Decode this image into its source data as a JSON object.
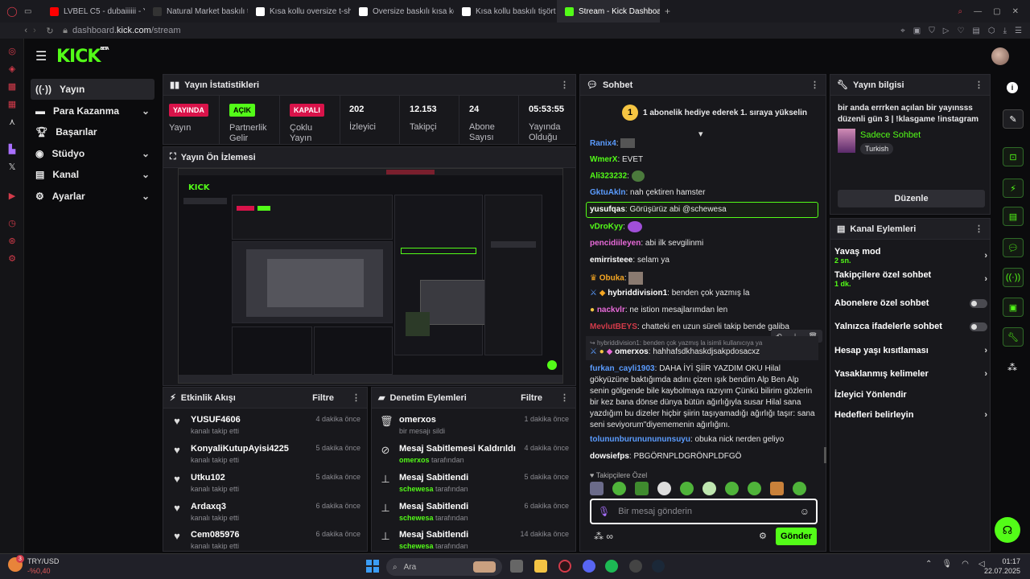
{
  "browser": {
    "tabs": [
      "LVBEL C5 - dubaiiiiii - Yo",
      "Natural Market baskılı t-s",
      "Kısa kollu oversize t-shirt",
      "Oversize baskılı kısa kollu",
      "Kısa kollu baskılı tişört - T",
      "Stream - Kick Dashboard"
    ],
    "address_prefix": "dashboard.",
    "address_host": "kick.com",
    "address_path": "/stream"
  },
  "brand": {
    "logo": "KICK",
    "beta": "BETA",
    "accent": "#53fc18"
  },
  "nav": [
    {
      "label": "Yayın",
      "icon": "broadcast-icon"
    },
    {
      "label": "Para Kazanma",
      "icon": "money-icon"
    },
    {
      "label": "Başarılar",
      "icon": "trophy-icon"
    },
    {
      "label": "Stüdyo",
      "icon": "studio-icon"
    },
    {
      "label": "Kanal",
      "icon": "channel-icon"
    },
    {
      "label": "Ayarlar",
      "icon": "gear-icon"
    }
  ],
  "stats": {
    "title": "Yayın İstatistikleri",
    "items": [
      {
        "badge": "YAYINDA",
        "label": "Yayın"
      },
      {
        "badge": "AÇIK",
        "label": "Partnerlik Gelir"
      },
      {
        "badge": "KAPALI",
        "label": "Çoklu Yayın"
      },
      {
        "value": "202",
        "label": "İzleyici"
      },
      {
        "value": "12.153",
        "label": "Takipçi"
      },
      {
        "value": "24",
        "label": "Abone Sayısı"
      },
      {
        "value": "05:53:55",
        "label": "Yayında Olduğu"
      }
    ]
  },
  "preview": {
    "title": "Yayın Ön İzlemesi"
  },
  "activity": {
    "title": "Etkinlik Akışı",
    "filter": "Filtre",
    "items": [
      {
        "name": "YUSUF4606",
        "action": "kanalı takip etti",
        "time": "4 dakika önce"
      },
      {
        "name": "KonyaliKutupAyisi4225",
        "action": "kanalı takip etti",
        "time": "5 dakika önce"
      },
      {
        "name": "Utku102",
        "action": "kanalı takip etti",
        "time": "5 dakika önce"
      },
      {
        "name": "Ardaxq3",
        "action": "kanalı takip etti",
        "time": "6 dakika önce"
      },
      {
        "name": "Cem085976",
        "action": "kanalı takip etti",
        "time": "6 dakika önce"
      }
    ]
  },
  "moderation": {
    "title": "Denetim Eylemleri",
    "filter": "Filtre",
    "items": [
      {
        "name": "omerxos",
        "action": "bir mesajı sildi",
        "by": "",
        "time": "1 dakika önce",
        "icon": "trash-icon"
      },
      {
        "name": "Mesaj Sabitlemesi Kaldırıldı",
        "action": "tarafından",
        "by": "omerxos",
        "time": "4 dakika önce",
        "icon": "unpin-icon"
      },
      {
        "name": "Mesaj Sabitlendi",
        "action": "tarafından",
        "by": "schewesa",
        "time": "5 dakika önce",
        "icon": "pin-icon"
      },
      {
        "name": "Mesaj Sabitlendi",
        "action": "tarafından",
        "by": "schewesa",
        "time": "6 dakika önce",
        "icon": "pin-icon"
      },
      {
        "name": "Mesaj Sabitlendi",
        "action": "tarafından",
        "by": "schewesa",
        "time": "14 dakika önce",
        "icon": "pin-icon"
      }
    ]
  },
  "chat": {
    "title": "Sohbet",
    "gift": "1 abonelik hediye ederek 1. sıraya yükselin",
    "gift_rank": "1",
    "messages": [
      {
        "user": "Ranix4",
        "color": "#5b9cff",
        "text": ""
      },
      {
        "user": "WmerX",
        "color": "#53fc18",
        "text": "EVET"
      },
      {
        "user": "Ali323232",
        "color": "#53fc18",
        "text": ""
      },
      {
        "user": "GktuAkln",
        "color": "#5b9cff",
        "text": "nah çektiren hamster"
      },
      {
        "user": "yusufqas",
        "color": "#ffffff",
        "text": "Görüşürüz abi @schewesa"
      },
      {
        "user": "vDroKyy",
        "color": "#53fc18",
        "text": ""
      },
      {
        "user": "pencidiileyen",
        "color": "#e86ad9",
        "text": "abi ilk sevgilinmi"
      },
      {
        "user": "emirristeee",
        "color": "#ffffff",
        "text": "selam ya"
      },
      {
        "user": "Obuka",
        "color": "#f5a623",
        "text": ""
      },
      {
        "user": "hybriddivision1",
        "color": "#ffffff",
        "text": "benden çok yazmış la"
      },
      {
        "user": "nackvlr",
        "color": "#e86ad9",
        "text": "ne istion mesajlarımdan len"
      },
      {
        "user": "MevlutBEYS",
        "color": "#d33b4a",
        "text": "chatteki en uzun süreli takip bende galiba"
      },
      {
        "user": "omerxos",
        "color": "#ffffff",
        "text": "hahhafsdkhaskdjsakpdosacxz"
      },
      {
        "user": "furkan_cayli1903",
        "color": "#5b9cff",
        "text": "DAHA İYİ ŞİİR YAZDIM OKU Hilal gökyüzüne baktığımda adını çizen ışık bendim Alp Ben Alp senin gölgende bile kaybolmaya razıyım Çünkü bilirim gözlerin bir kez bana dönse dünya bütün ağırlığıyla susar Hilal sana yazdığım bu dizeler hiçbir şiirin taşıyamadığı ağırlığı taşır: sana seni seviyorum\"diyememenin ağırlığını."
      },
      {
        "user": "tolununburununununsuyu",
        "color": "#5b9cff",
        "text": "obuka nick nerden geliyo"
      },
      {
        "user": "dowsiefps",
        "color": "#ffffff",
        "text": "PBGÖRNPLDGRÖNPLDFGÖ"
      }
    ],
    "reply_to": "hybriddivision1: benden çok yazmış la isimli kullanıcıya ya",
    "followers_only": "Takipçilere Özel",
    "placeholder": "Bir mesaj gönderin",
    "send": "Gönder"
  },
  "info": {
    "title": "Yayın bilgisi",
    "stream_title": "bir anda errrken açılan bir yayınsss düzenli gün 3 | !klasgame !instagram",
    "category": "Sadece Sohbet",
    "tag": "Turkish",
    "edit": "Düzenle"
  },
  "actions": {
    "title": "Kanal Eylemleri",
    "items": [
      {
        "label": "Yavaş mod",
        "sub": "2 sn.",
        "type": "chevron"
      },
      {
        "label": "Takipçilere özel sohbet",
        "sub": "1 dk.",
        "type": "chevron"
      },
      {
        "label": "Abonelere özel sohbet",
        "sub": "",
        "type": "toggle"
      },
      {
        "label": "Yalnızca ifadelerle sohbet",
        "sub": "",
        "type": "toggle"
      },
      {
        "label": "Hesap yaşı kısıtlaması",
        "sub": "",
        "type": "chevron"
      },
      {
        "label": "Yasaklanmış kelimeler",
        "sub": "",
        "type": "chevron"
      },
      {
        "label": "İzleyici Yönlendir",
        "sub": "",
        "type": "none"
      },
      {
        "label": "Hedefleri belirleyin",
        "sub": "",
        "type": "chevron"
      }
    ]
  },
  "taskbar": {
    "ticker": "TRY/USD",
    "ticker_change": "-%0,40",
    "search": "Ara",
    "time": "01:17",
    "date": "22.07.2025",
    "badge": "3"
  }
}
